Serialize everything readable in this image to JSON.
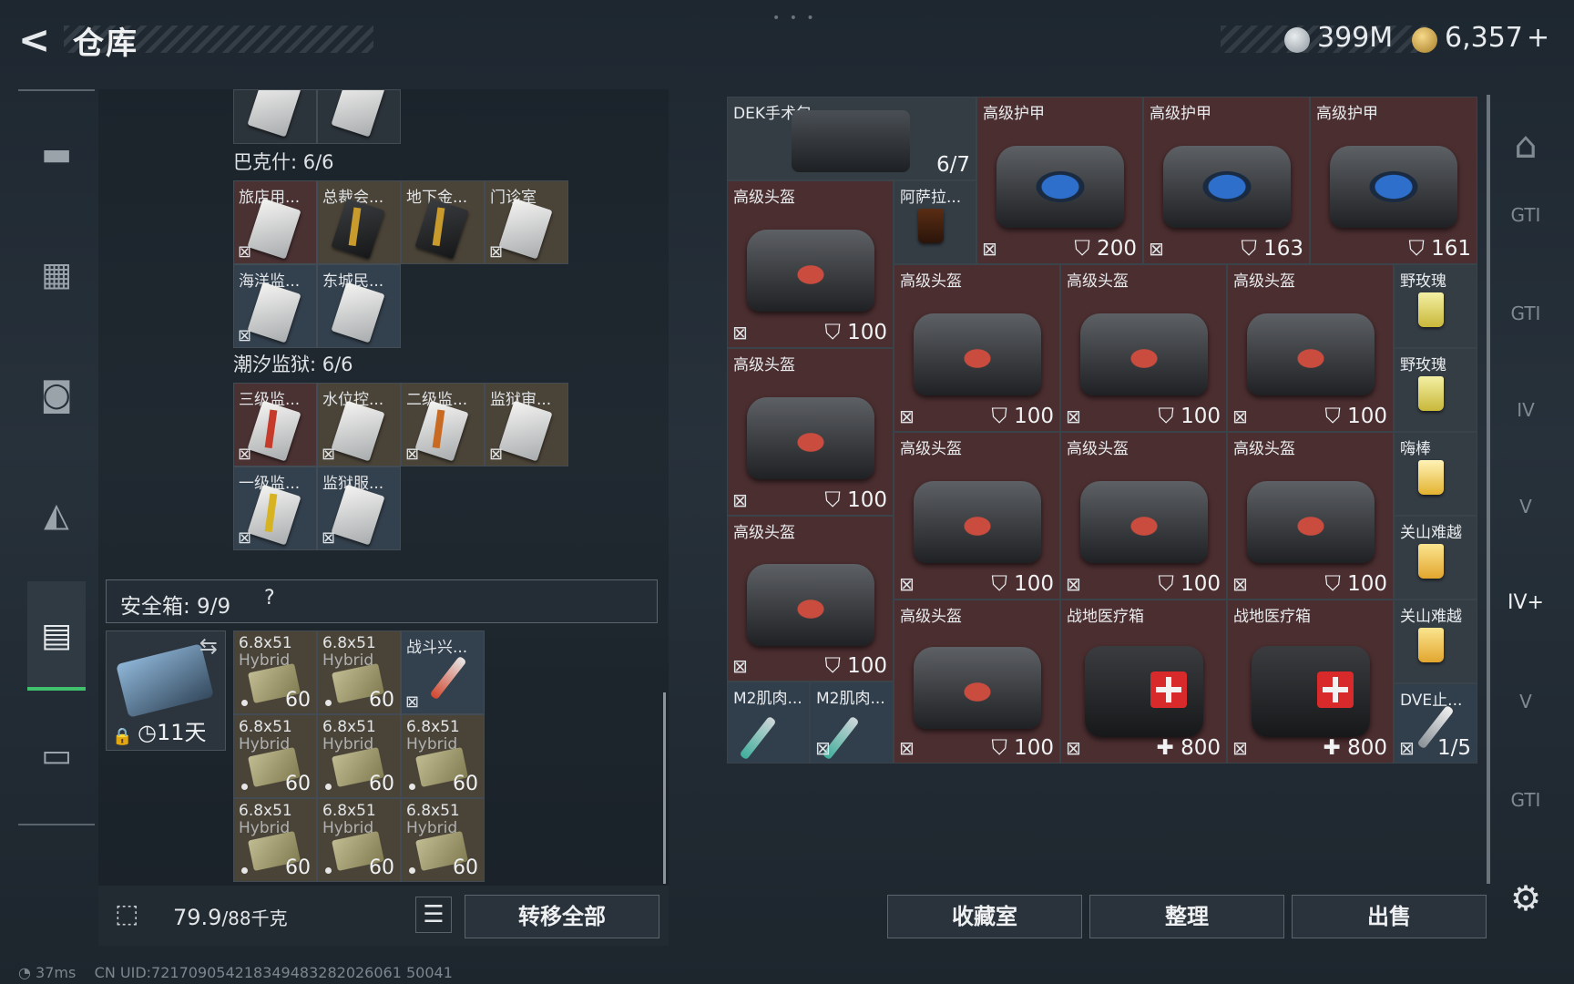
{
  "header": {
    "back": "<",
    "title": "仓库",
    "silver_amount": "399M",
    "gold_amount": "6,357",
    "gold_plus": "+",
    "handle": "• • •"
  },
  "rail_icons": [
    "▬",
    "▦",
    "◙",
    "◭",
    "▤",
    "▭"
  ],
  "left": {
    "top_cells": [
      "",
      ""
    ],
    "section1": "巴克什: 6/6",
    "bakhsh_items": [
      {
        "name": "旅店用..."
      },
      {
        "name": "总裁会..."
      },
      {
        "name": "地下金..."
      },
      {
        "name": "门诊室"
      },
      {
        "name": "海洋监..."
      },
      {
        "name": "东城民..."
      }
    ],
    "section2": "潮汐监狱: 6/6",
    "prison_items": [
      {
        "name": "三级监..."
      },
      {
        "name": "水位控..."
      },
      {
        "name": "二级监..."
      },
      {
        "name": "监狱审..."
      },
      {
        "name": "一级监..."
      },
      {
        "name": "监狱服..."
      }
    ],
    "safe_label": "安全箱: 9/9",
    "safe_help": "?",
    "safe_swap": "⇆",
    "safe_days": "11天",
    "ammo": [
      {
        "name": "6.8x51",
        "sub": "Hybrid",
        "val": "60"
      },
      {
        "name": "6.8x51",
        "sub": "Hybrid",
        "val": "60"
      },
      {
        "name": "战斗兴...",
        "sub": "",
        "val": ""
      },
      {
        "name": "6.8x51",
        "sub": "Hybrid",
        "val": "60"
      },
      {
        "name": "6.8x51",
        "sub": "Hybrid",
        "val": "60"
      },
      {
        "name": "6.8x51",
        "sub": "Hybrid",
        "val": "60"
      },
      {
        "name": "6.8x51",
        "sub": "Hybrid",
        "val": "60"
      },
      {
        "name": "6.8x51",
        "sub": "Hybrid",
        "val": "60"
      },
      {
        "name": "6.8x51",
        "sub": "Hybrid",
        "val": "60"
      }
    ],
    "weight_value": "79.9",
    "weight_max": "/88千克",
    "transfer_all": "转移全部"
  },
  "right": {
    "surgery": {
      "name": "DEK手术包",
      "val": "6/7"
    },
    "armor": [
      {
        "name": "高级护甲",
        "val": "200"
      },
      {
        "name": "高级护甲",
        "val": "163"
      },
      {
        "name": "高级护甲",
        "val": "161"
      }
    ],
    "assad": "阿萨拉...",
    "helmets_col1": [
      {
        "name": "高级头盔",
        "val": "100"
      },
      {
        "name": "高级头盔",
        "val": "100"
      },
      {
        "name": "高级头盔",
        "val": "100"
      }
    ],
    "helmets_grid": [
      {
        "name": "高级头盔",
        "val": "100"
      },
      {
        "name": "高级头盔",
        "val": "100"
      },
      {
        "name": "高级头盔",
        "val": "100"
      },
      {
        "name": "高级头盔",
        "val": "100"
      },
      {
        "name": "高级头盔",
        "val": "100"
      },
      {
        "name": "高级头盔",
        "val": "100"
      },
      {
        "name": "高级头盔",
        "val": "100"
      }
    ],
    "medkits": [
      {
        "name": "战地医疗箱",
        "val": "800"
      },
      {
        "name": "战地医疗箱",
        "val": "800"
      }
    ],
    "drinks": [
      "野玫瑰",
      "野玫瑰",
      "嗨棒",
      "关山难越",
      "关山难越"
    ],
    "m2": [
      "M2肌肉...",
      "M2肌肉..."
    ],
    "dve": {
      "name": "DVE止...",
      "val": "1/5"
    },
    "btn_collection": "收藏室",
    "btn_sort": "整理",
    "btn_sell": "出售"
  },
  "right_rail_icons": [
    "⌂",
    "GTI",
    "GTI",
    "IV",
    "V",
    "IV+",
    "V",
    "GTI"
  ],
  "settings_icon": "⚙",
  "footer": {
    "ping": "37ms",
    "uid": "CN UID:721709054218349483282026061 50041"
  }
}
